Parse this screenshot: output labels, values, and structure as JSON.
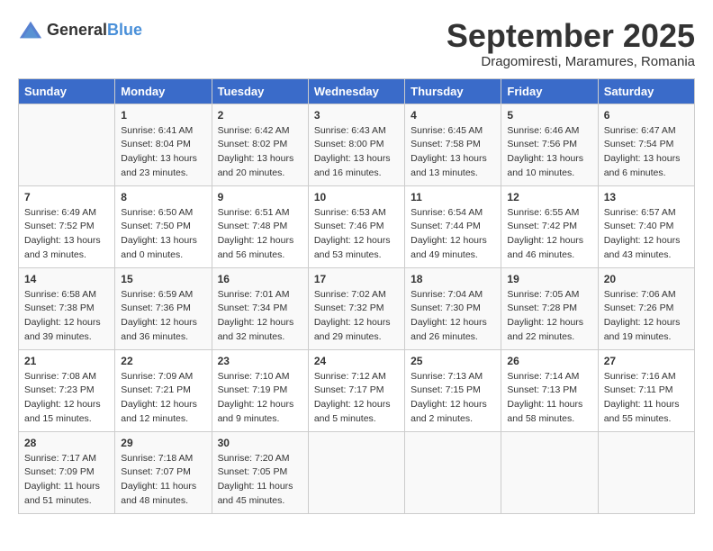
{
  "logo": {
    "general": "General",
    "blue": "Blue"
  },
  "title": "September 2025",
  "subtitle": "Dragomiresti, Maramures, Romania",
  "weekdays": [
    "Sunday",
    "Monday",
    "Tuesday",
    "Wednesday",
    "Thursday",
    "Friday",
    "Saturday"
  ],
  "weeks": [
    [
      {
        "day": "",
        "sunrise": "",
        "sunset": "",
        "daylight": ""
      },
      {
        "day": "1",
        "sunrise": "Sunrise: 6:41 AM",
        "sunset": "Sunset: 8:04 PM",
        "daylight": "Daylight: 13 hours and 23 minutes."
      },
      {
        "day": "2",
        "sunrise": "Sunrise: 6:42 AM",
        "sunset": "Sunset: 8:02 PM",
        "daylight": "Daylight: 13 hours and 20 minutes."
      },
      {
        "day": "3",
        "sunrise": "Sunrise: 6:43 AM",
        "sunset": "Sunset: 8:00 PM",
        "daylight": "Daylight: 13 hours and 16 minutes."
      },
      {
        "day": "4",
        "sunrise": "Sunrise: 6:45 AM",
        "sunset": "Sunset: 7:58 PM",
        "daylight": "Daylight: 13 hours and 13 minutes."
      },
      {
        "day": "5",
        "sunrise": "Sunrise: 6:46 AM",
        "sunset": "Sunset: 7:56 PM",
        "daylight": "Daylight: 13 hours and 10 minutes."
      },
      {
        "day": "6",
        "sunrise": "Sunrise: 6:47 AM",
        "sunset": "Sunset: 7:54 PM",
        "daylight": "Daylight: 13 hours and 6 minutes."
      }
    ],
    [
      {
        "day": "7",
        "sunrise": "Sunrise: 6:49 AM",
        "sunset": "Sunset: 7:52 PM",
        "daylight": "Daylight: 13 hours and 3 minutes."
      },
      {
        "day": "8",
        "sunrise": "Sunrise: 6:50 AM",
        "sunset": "Sunset: 7:50 PM",
        "daylight": "Daylight: 13 hours and 0 minutes."
      },
      {
        "day": "9",
        "sunrise": "Sunrise: 6:51 AM",
        "sunset": "Sunset: 7:48 PM",
        "daylight": "Daylight: 12 hours and 56 minutes."
      },
      {
        "day": "10",
        "sunrise": "Sunrise: 6:53 AM",
        "sunset": "Sunset: 7:46 PM",
        "daylight": "Daylight: 12 hours and 53 minutes."
      },
      {
        "day": "11",
        "sunrise": "Sunrise: 6:54 AM",
        "sunset": "Sunset: 7:44 PM",
        "daylight": "Daylight: 12 hours and 49 minutes."
      },
      {
        "day": "12",
        "sunrise": "Sunrise: 6:55 AM",
        "sunset": "Sunset: 7:42 PM",
        "daylight": "Daylight: 12 hours and 46 minutes."
      },
      {
        "day": "13",
        "sunrise": "Sunrise: 6:57 AM",
        "sunset": "Sunset: 7:40 PM",
        "daylight": "Daylight: 12 hours and 43 minutes."
      }
    ],
    [
      {
        "day": "14",
        "sunrise": "Sunrise: 6:58 AM",
        "sunset": "Sunset: 7:38 PM",
        "daylight": "Daylight: 12 hours and 39 minutes."
      },
      {
        "day": "15",
        "sunrise": "Sunrise: 6:59 AM",
        "sunset": "Sunset: 7:36 PM",
        "daylight": "Daylight: 12 hours and 36 minutes."
      },
      {
        "day": "16",
        "sunrise": "Sunrise: 7:01 AM",
        "sunset": "Sunset: 7:34 PM",
        "daylight": "Daylight: 12 hours and 32 minutes."
      },
      {
        "day": "17",
        "sunrise": "Sunrise: 7:02 AM",
        "sunset": "Sunset: 7:32 PM",
        "daylight": "Daylight: 12 hours and 29 minutes."
      },
      {
        "day": "18",
        "sunrise": "Sunrise: 7:04 AM",
        "sunset": "Sunset: 7:30 PM",
        "daylight": "Daylight: 12 hours and 26 minutes."
      },
      {
        "day": "19",
        "sunrise": "Sunrise: 7:05 AM",
        "sunset": "Sunset: 7:28 PM",
        "daylight": "Daylight: 12 hours and 22 minutes."
      },
      {
        "day": "20",
        "sunrise": "Sunrise: 7:06 AM",
        "sunset": "Sunset: 7:26 PM",
        "daylight": "Daylight: 12 hours and 19 minutes."
      }
    ],
    [
      {
        "day": "21",
        "sunrise": "Sunrise: 7:08 AM",
        "sunset": "Sunset: 7:23 PM",
        "daylight": "Daylight: 12 hours and 15 minutes."
      },
      {
        "day": "22",
        "sunrise": "Sunrise: 7:09 AM",
        "sunset": "Sunset: 7:21 PM",
        "daylight": "Daylight: 12 hours and 12 minutes."
      },
      {
        "day": "23",
        "sunrise": "Sunrise: 7:10 AM",
        "sunset": "Sunset: 7:19 PM",
        "daylight": "Daylight: 12 hours and 9 minutes."
      },
      {
        "day": "24",
        "sunrise": "Sunrise: 7:12 AM",
        "sunset": "Sunset: 7:17 PM",
        "daylight": "Daylight: 12 hours and 5 minutes."
      },
      {
        "day": "25",
        "sunrise": "Sunrise: 7:13 AM",
        "sunset": "Sunset: 7:15 PM",
        "daylight": "Daylight: 12 hours and 2 minutes."
      },
      {
        "day": "26",
        "sunrise": "Sunrise: 7:14 AM",
        "sunset": "Sunset: 7:13 PM",
        "daylight": "Daylight: 11 hours and 58 minutes."
      },
      {
        "day": "27",
        "sunrise": "Sunrise: 7:16 AM",
        "sunset": "Sunset: 7:11 PM",
        "daylight": "Daylight: 11 hours and 55 minutes."
      }
    ],
    [
      {
        "day": "28",
        "sunrise": "Sunrise: 7:17 AM",
        "sunset": "Sunset: 7:09 PM",
        "daylight": "Daylight: 11 hours and 51 minutes."
      },
      {
        "day": "29",
        "sunrise": "Sunrise: 7:18 AM",
        "sunset": "Sunset: 7:07 PM",
        "daylight": "Daylight: 11 hours and 48 minutes."
      },
      {
        "day": "30",
        "sunrise": "Sunrise: 7:20 AM",
        "sunset": "Sunset: 7:05 PM",
        "daylight": "Daylight: 11 hours and 45 minutes."
      },
      {
        "day": "",
        "sunrise": "",
        "sunset": "",
        "daylight": ""
      },
      {
        "day": "",
        "sunrise": "",
        "sunset": "",
        "daylight": ""
      },
      {
        "day": "",
        "sunrise": "",
        "sunset": "",
        "daylight": ""
      },
      {
        "day": "",
        "sunrise": "",
        "sunset": "",
        "daylight": ""
      }
    ]
  ]
}
